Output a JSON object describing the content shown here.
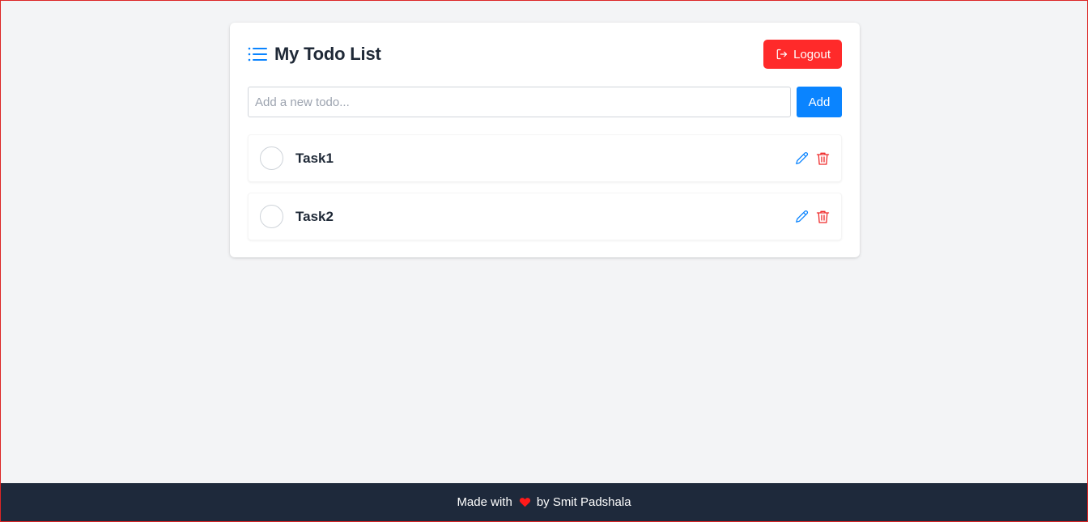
{
  "header": {
    "title": "My Todo List",
    "logout_label": "Logout"
  },
  "add_form": {
    "placeholder": "Add a new todo...",
    "value": "",
    "add_label": "Add"
  },
  "todos": [
    {
      "label": "Task1",
      "completed": false
    },
    {
      "label": "Task2",
      "completed": false
    }
  ],
  "footer": {
    "prefix": "Made with",
    "suffix": "by Smit Padshala"
  },
  "icons": {
    "title": "list-icon",
    "logout": "logout-icon",
    "edit": "pencil-icon",
    "delete": "trash-icon",
    "footer": "heart-icon"
  },
  "colors": {
    "accent_blue": "#0a84ff",
    "danger_red": "#ff2a2a",
    "footer_bg": "#1e293b",
    "page_bg": "#f3f4f6"
  }
}
